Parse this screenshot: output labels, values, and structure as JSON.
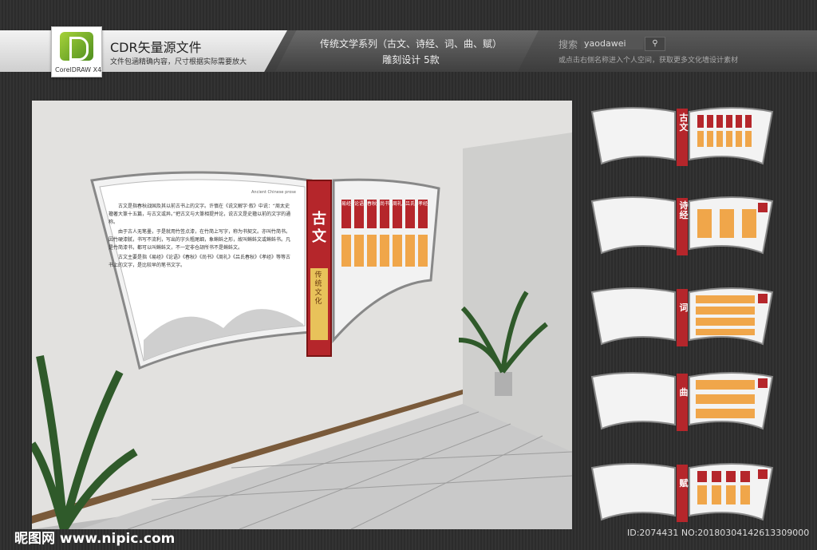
{
  "header": {
    "logo_text": "CorelDRAW X4",
    "title": "CDR矢量源文件",
    "subtitle": "文件包涵精确内容，尺寸根据实际需要放大",
    "series_line1": "传统文学系列（古文、诗经、词、曲、赋）",
    "series_line2": "雕刻设计  5款",
    "search_label": "搜索",
    "search_value": "yaodawei",
    "search_icon": "magnifier-icon",
    "hint": "或点击右侧名称进入个人空间，获取更多文化墙设计素材"
  },
  "scene": {
    "label_title": "古文",
    "label_sub": "传统文化",
    "english_tag": "Ancient Chinese prose",
    "paragraphs": [
      "古文是指春秋战国及其以前古书上的文字。许慎在《说文解字·叙》中说：“周太史籀著大篆十五篇，与古文或异。”把古文与大篆相提并论，说古文是史籀以前的文字的通称。",
      "由于古人无笔墨，于是就用竹签点漆，在竹简上写字，称为书契文。亦叫竹简书。因竹硬漆腻，书写不流利，写出的字头粗尾细，象蝌蚪之形，故叫蝌蚪文或蝌蚪书。凡是竹简漆书，都可以叫蝌蚪文，不一定非仓颉所书不是蝌蚪文。",
      "古文主要是指《易经》《论语》《春秋》《尚书》《周礼》《吕氏春秋》《孝经》等等古书上的文字，是比较早的笔书文字。"
    ],
    "book_titles": [
      "易经",
      "论语",
      "春秋",
      "尚书",
      "周礼",
      "吕氏",
      "孝经"
    ],
    "colors": {
      "accent": "#b5262b",
      "orange": "#f0a64a",
      "panel": "#ececec"
    }
  },
  "thumbnails": [
    {
      "label": "古文"
    },
    {
      "label": "诗经"
    },
    {
      "label": "词"
    },
    {
      "label": "曲"
    },
    {
      "label": "赋"
    }
  ],
  "footer": {
    "watermark": "昵图网 www.nipic.com",
    "id_text": "ID:2074431 NO:20180304142613309000"
  }
}
